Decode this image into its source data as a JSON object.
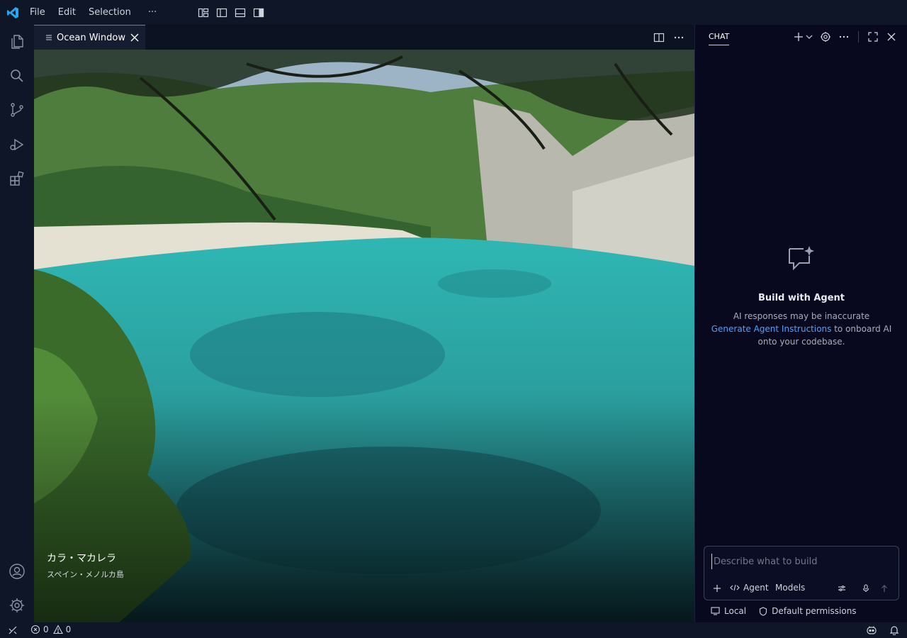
{
  "menu": {
    "file": "File",
    "edit": "Edit",
    "selection": "Selection",
    "more": "···"
  },
  "editor": {
    "tab_title": "Ocean Window",
    "caption_title": "カラ・マカレラ",
    "caption_subtitle": "スペイン・メノルカ島"
  },
  "chat": {
    "tab_label": "CHAT",
    "empty_title": "Build with Agent",
    "empty_line1": "AI responses may be inaccurate",
    "empty_link": "Generate Agent Instructions",
    "empty_line2": " to onboard AI onto your codebase.",
    "input_placeholder": "Describe what to build",
    "agent_label": "Agent",
    "models_label": "Models",
    "local_label": "Local",
    "permissions_label": "Default permissions"
  },
  "status": {
    "errors": "0",
    "warnings": "0"
  },
  "colors": {
    "accent": "#3a86ff",
    "link": "#4aa3ff",
    "logo": "#23a9f2",
    "background": "#0f1628",
    "chat_bg": "#08091e"
  },
  "icons": [
    "vscode-logo-icon",
    "files-icon",
    "search-icon",
    "source-control-icon",
    "run-debug-icon",
    "extensions-icon",
    "account-icon",
    "settings-gear-icon",
    "split-editor-icon",
    "more-icon",
    "close-icon",
    "plus-icon",
    "chevron-down-icon",
    "maximize-icon",
    "sparkle-chat-icon",
    "attach-icon",
    "tools-icon",
    "mic-icon",
    "send-icon",
    "remote-icon",
    "error-icon",
    "warning-icon",
    "copilot-icon",
    "bell-icon",
    "shield-icon",
    "monitor-icon"
  ]
}
